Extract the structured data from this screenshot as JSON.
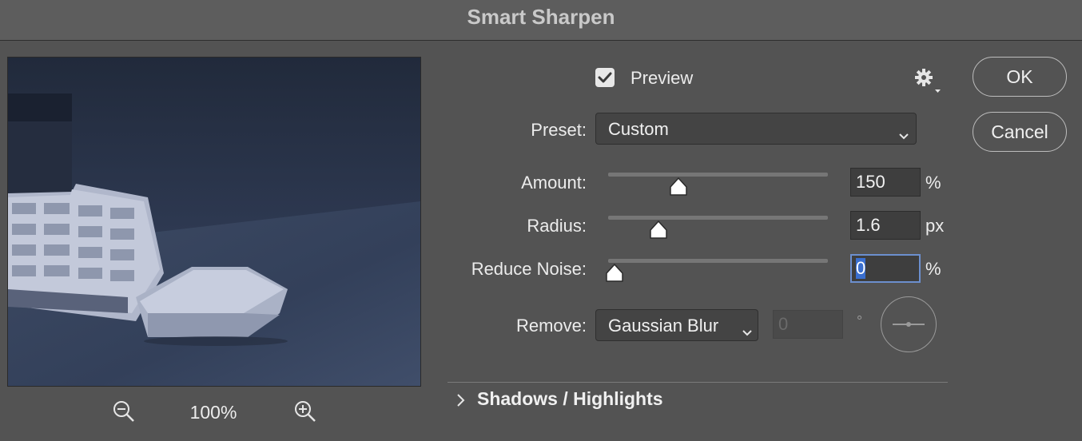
{
  "dialog": {
    "title": "Smart Sharpen"
  },
  "preview_panel": {
    "zoom_level": "100%",
    "zoom_out_icon": "zoom-out-icon",
    "zoom_in_icon": "zoom-in-icon"
  },
  "options": {
    "preview_label": "Preview",
    "preview_checked": true,
    "settings_icon": "gear-icon",
    "preset_label": "Preset:",
    "preset_value": "Custom"
  },
  "sliders": {
    "amount": {
      "label": "Amount:",
      "value": "150",
      "unit": "%",
      "fraction": 0.29
    },
    "radius": {
      "label": "Radius:",
      "value": "1.6",
      "unit": "px",
      "fraction": 0.2
    },
    "reduce_noise": {
      "label": "Reduce Noise:",
      "value": "0",
      "unit": "%",
      "fraction": 0.0
    }
  },
  "remove": {
    "label": "Remove:",
    "value": "Gaussian Blur",
    "angle_value": "0",
    "angle_unit": "°"
  },
  "sections": {
    "shadows_highlights_label": "Shadows / Highlights"
  },
  "buttons": {
    "ok_label": "OK",
    "cancel_label": "Cancel"
  },
  "colors": {
    "background": "#535353",
    "focus_accent": "#6c8fce",
    "selection": "#3a6fcf"
  }
}
